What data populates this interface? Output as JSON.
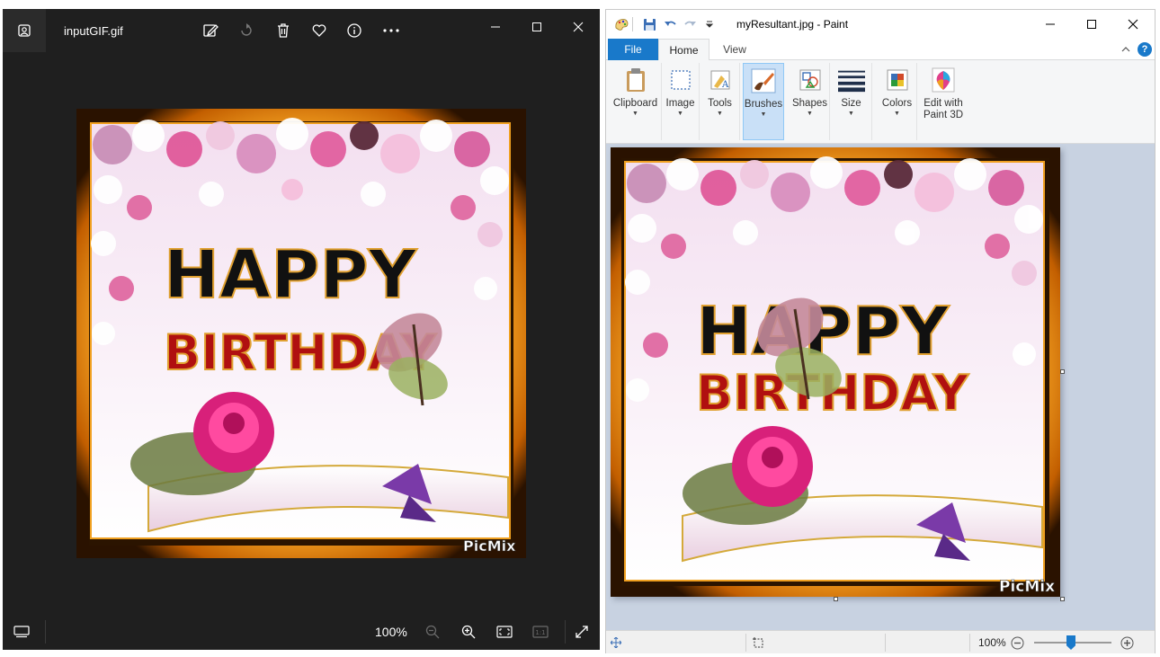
{
  "photos": {
    "file_name": "inputGIF.gif",
    "zoom": "100%",
    "toolbar_icons": [
      "edit-icon",
      "rotate-icon",
      "delete-icon",
      "favorite-icon",
      "info-icon",
      "more-icon"
    ],
    "bottom_icons": [
      "filmstrip-icon",
      "zoom-out-icon",
      "zoom-in-icon",
      "fit-icon",
      "actual-size-icon",
      "fullscreen-icon"
    ],
    "actual_size_label": "1:1"
  },
  "image": {
    "line1": "HAPPY",
    "line2": "BIRTHDAY",
    "watermark": "PicMix"
  },
  "paint": {
    "title": "myResultant.jpg - Paint",
    "tabs": {
      "file": "File",
      "home": "Home",
      "view": "View"
    },
    "groups": {
      "clipboard": "Clipboard",
      "image": "Image",
      "tools": "Tools",
      "brushes": "Brushes",
      "shapes": "Shapes",
      "size": "Size",
      "colors": "Colors",
      "paint3d": "Edit with Paint 3D"
    },
    "zoom": "100%"
  },
  "colors": {
    "photos_bg": "#1f1f1f",
    "paint_accent": "#1979ca",
    "canvas_bg": "#c8d2e1",
    "frame_orange": "#e8900c"
  }
}
